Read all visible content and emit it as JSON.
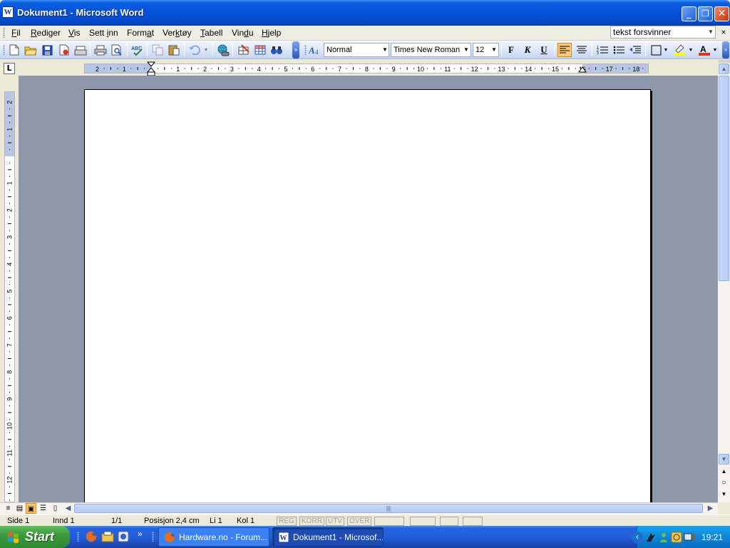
{
  "window": {
    "title": "Dokument1 - Microsoft Word",
    "app_icon_letter": "W",
    "minimize": "_",
    "maximize": "❐",
    "close": "✕"
  },
  "menu": {
    "items": [
      {
        "label": "Fil",
        "accel": "F",
        "rest": "il"
      },
      {
        "label": "Rediger",
        "accel": "R",
        "rest": "ediger"
      },
      {
        "label": "Vis",
        "accel": "V",
        "rest": "is"
      },
      {
        "label": "Sett inn",
        "pre": "Sett ",
        "accel": "i",
        "rest": "nn"
      },
      {
        "label": "Format",
        "pre": "Form",
        "accel": "a",
        "rest": "t"
      },
      {
        "label": "Verktøy",
        "pre": "Ver",
        "accel": "k",
        "rest": "tøy"
      },
      {
        "label": "Tabell",
        "accel": "T",
        "rest": "abell"
      },
      {
        "label": "Vindu",
        "pre": "Vin",
        "accel": "d",
        "rest": "u"
      },
      {
        "label": "Hjelp",
        "accel": "H",
        "rest": "jelp"
      }
    ],
    "help_query": "tekst forsvinner",
    "doc_close": "×"
  },
  "toolbar": {
    "style": "Normal",
    "font": "Times New Roman",
    "size": "12",
    "bold": "F",
    "italic": "K",
    "underline": "U",
    "overflow": "»"
  },
  "ruler": {
    "tab_selector": "L",
    "h_labels": [
      "2",
      "1",
      "1",
      "2",
      "3",
      "4",
      "5",
      "6",
      "7",
      "8",
      "9",
      "10",
      "11",
      "12",
      "13",
      "14",
      "15",
      "16",
      "17",
      "18"
    ],
    "v_labels": [
      "2",
      "1",
      "1",
      "2",
      "3",
      "4",
      "5",
      "6",
      "7",
      "8",
      "9",
      "10",
      "11",
      "12"
    ]
  },
  "scrollbar": {
    "up": "▲",
    "down": "▼",
    "prev": "▲",
    "browse": "○",
    "next": "▼",
    "left": "◀",
    "right": "▶",
    "grip": "|||"
  },
  "status": {
    "page": "Side 1",
    "section": "Innd 1",
    "pages": "1/1",
    "position": "Posisjon 2,4 cm",
    "line": "Li 1",
    "column": "Kol 1",
    "modes": [
      "REG",
      "KORR",
      "UTV",
      "OVER"
    ]
  },
  "taskbar": {
    "start": "Start",
    "quicklaunch_more": "»",
    "tasks": [
      {
        "label": "Hardware.no - Forum...",
        "active": false
      },
      {
        "label": "Dokument1 - Microsof...",
        "active": true
      }
    ],
    "tray_expand": "‹",
    "clock": "19:21"
  },
  "colors": {
    "titlebar": "#0451d8",
    "start_green": "#3c9a3c",
    "doc_background": "#8f97ab",
    "active_highlight": "#ffc97a"
  }
}
